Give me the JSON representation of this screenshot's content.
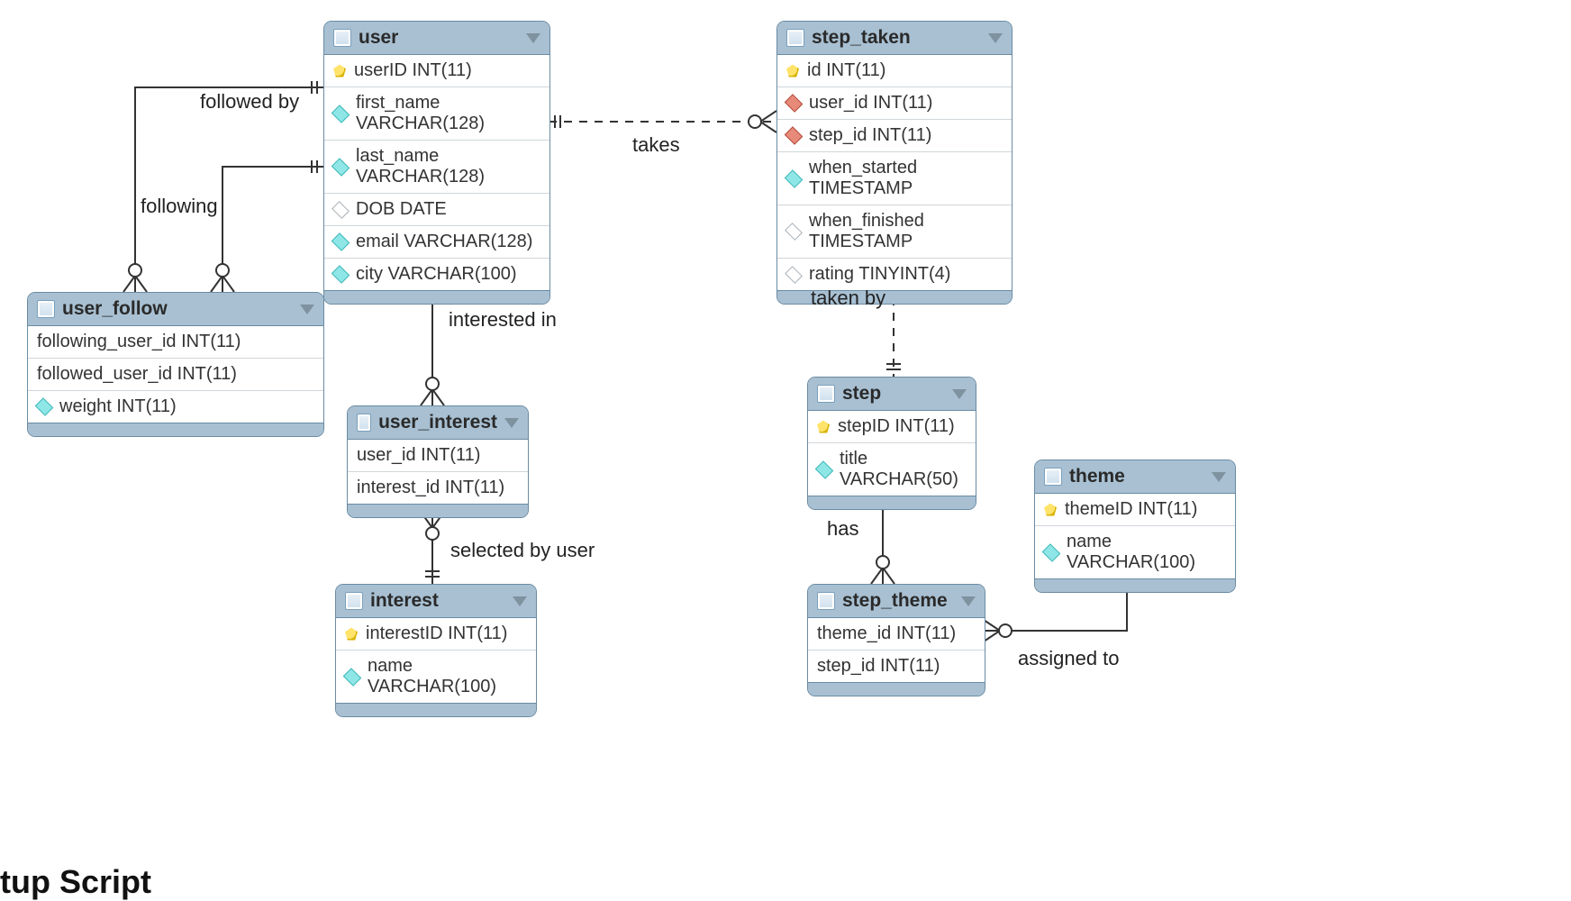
{
  "entities": {
    "user": {
      "title": "user",
      "cols": [
        {
          "icon": "pk",
          "text": "userID INT(11)"
        },
        {
          "icon": "diamond-cyan",
          "text": "first_name VARCHAR(128)"
        },
        {
          "icon": "diamond-cyan",
          "text": "last_name VARCHAR(128)"
        },
        {
          "icon": "diamond-open",
          "text": "DOB DATE"
        },
        {
          "icon": "diamond-cyan",
          "text": "email VARCHAR(128)"
        },
        {
          "icon": "diamond-cyan",
          "text": "city VARCHAR(100)"
        }
      ]
    },
    "step_taken": {
      "title": "step_taken",
      "cols": [
        {
          "icon": "pk",
          "text": "id INT(11)"
        },
        {
          "icon": "diamond-red",
          "text": "user_id INT(11)"
        },
        {
          "icon": "diamond-red",
          "text": "step_id INT(11)"
        },
        {
          "icon": "diamond-cyan",
          "text": "when_started TIMESTAMP"
        },
        {
          "icon": "diamond-open",
          "text": "when_finished TIMESTAMP"
        },
        {
          "icon": "diamond-open",
          "text": "rating TINYINT(4)"
        }
      ]
    },
    "user_follow": {
      "title": "user_follow",
      "cols": [
        {
          "icon": "",
          "text": "following_user_id INT(11)"
        },
        {
          "icon": "",
          "text": "followed_user_id INT(11)"
        },
        {
          "icon": "diamond-cyan",
          "text": "weight INT(11)"
        }
      ]
    },
    "user_interest": {
      "title": "user_interest",
      "cols": [
        {
          "icon": "",
          "text": "user_id INT(11)"
        },
        {
          "icon": "",
          "text": "interest_id INT(11)"
        }
      ]
    },
    "interest": {
      "title": "interest",
      "cols": [
        {
          "icon": "pk",
          "text": "interestID INT(11)"
        },
        {
          "icon": "diamond-cyan",
          "text": "name VARCHAR(100)"
        }
      ]
    },
    "step": {
      "title": "step",
      "cols": [
        {
          "icon": "pk",
          "text": "stepID INT(11)"
        },
        {
          "icon": "diamond-cyan",
          "text": "title VARCHAR(50)"
        }
      ]
    },
    "step_theme": {
      "title": "step_theme",
      "cols": [
        {
          "icon": "",
          "text": "theme_id INT(11)"
        },
        {
          "icon": "",
          "text": "step_id INT(11)"
        }
      ]
    },
    "theme": {
      "title": "theme",
      "cols": [
        {
          "icon": "pk",
          "text": "themeID INT(11)"
        },
        {
          "icon": "diamond-cyan",
          "text": "name VARCHAR(100)"
        }
      ]
    }
  },
  "labels": {
    "followed_by": "followed by",
    "following": "following",
    "takes": "takes",
    "interested_in": "interested in",
    "selected_by": "selected by user",
    "taken_by": "taken by",
    "has": "has",
    "assigned_to": "assigned to"
  },
  "footer": "tup Script"
}
